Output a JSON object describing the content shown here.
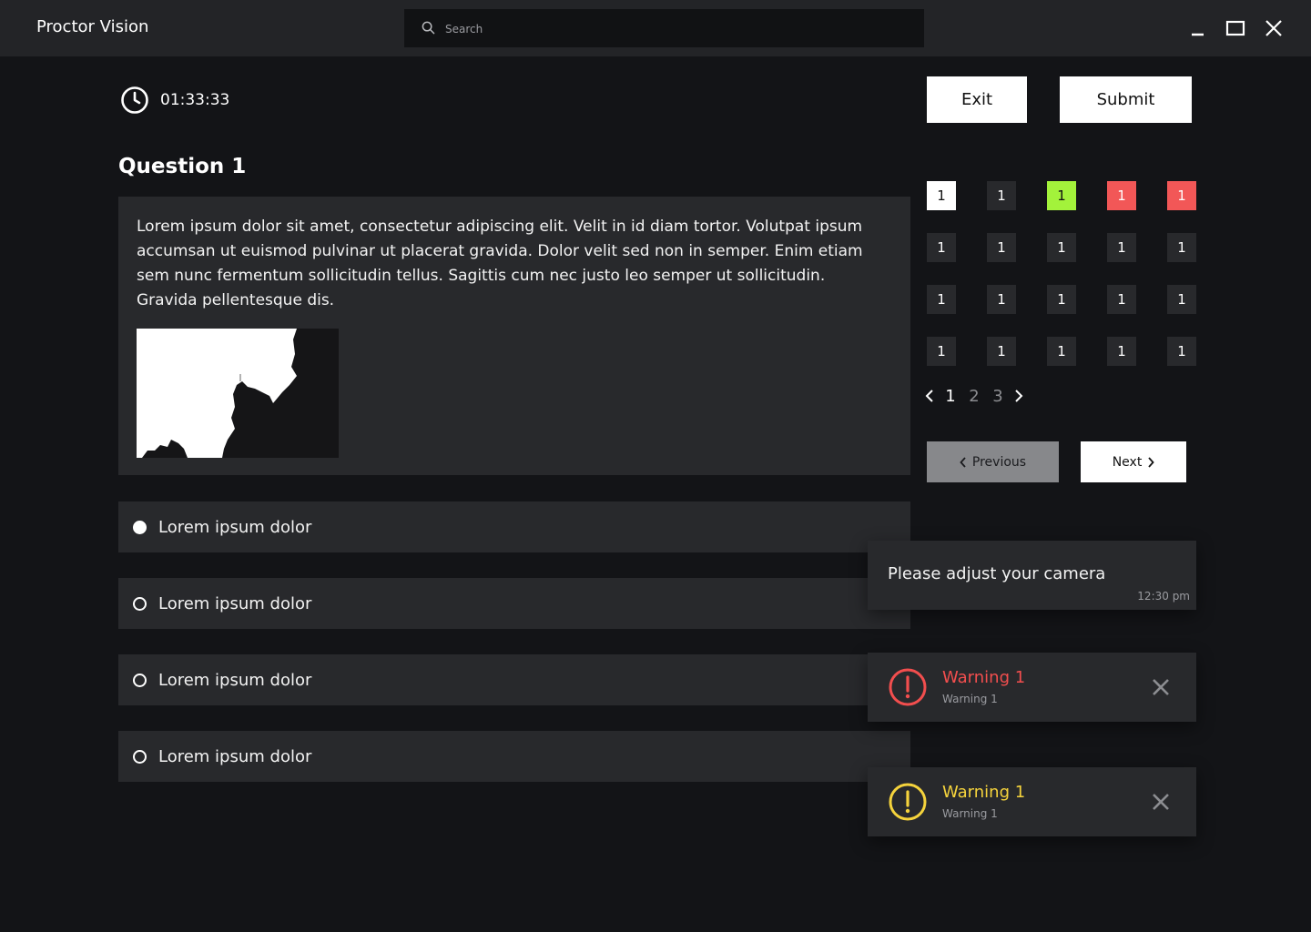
{
  "app": {
    "title": "Proctor Vision"
  },
  "search": {
    "placeholder": "Search"
  },
  "timer": {
    "value": "01:33:33"
  },
  "actions": {
    "exit": "Exit",
    "submit": "Submit"
  },
  "question": {
    "title": "Question 1",
    "text": "Lorem ipsum dolor sit amet, consectetur adipiscing elit. Velit in id diam tortor. Volutpat ipsum accumsan ut euismod pulvinar ut placerat gravida. Dolor velit sed non in semper. Enim etiam sem nunc fermentum sollicitudin tellus. Sagittis cum nec justo leo semper ut sollicitudin. Gravida pellentesque dis."
  },
  "options": [
    {
      "label": "Lorem ipsum dolor",
      "selected": true
    },
    {
      "label": "Lorem ipsum dolor",
      "selected": false
    },
    {
      "label": "Lorem ipsum dolor",
      "selected": false
    },
    {
      "label": "Lorem ipsum dolor",
      "selected": false
    }
  ],
  "question_grid": [
    {
      "label": "1",
      "status": "current"
    },
    {
      "label": "1",
      "status": "default"
    },
    {
      "label": "1",
      "status": "answered"
    },
    {
      "label": "1",
      "status": "flagged"
    },
    {
      "label": "1",
      "status": "flagged"
    },
    {
      "label": "1",
      "status": "default"
    },
    {
      "label": "1",
      "status": "default"
    },
    {
      "label": "1",
      "status": "default"
    },
    {
      "label": "1",
      "status": "default"
    },
    {
      "label": "1",
      "status": "default"
    },
    {
      "label": "1",
      "status": "default"
    },
    {
      "label": "1",
      "status": "default"
    },
    {
      "label": "1",
      "status": "default"
    },
    {
      "label": "1",
      "status": "default"
    },
    {
      "label": "1",
      "status": "default"
    },
    {
      "label": "1",
      "status": "default"
    },
    {
      "label": "1",
      "status": "default"
    },
    {
      "label": "1",
      "status": "default"
    },
    {
      "label": "1",
      "status": "default"
    },
    {
      "label": "1",
      "status": "default"
    }
  ],
  "pagination": {
    "pages": [
      "1",
      "2",
      "3"
    ],
    "current": "1"
  },
  "navigation": {
    "previous": "Previous",
    "next": "Next"
  },
  "message": {
    "text": "Please adjust your camera",
    "time": "12:30 pm"
  },
  "warnings": [
    {
      "title": "Warning 1",
      "subtitle": "Warning 1",
      "color": "#f24e4e",
      "icon": "alert-circle-icon"
    },
    {
      "title": "Warning 1",
      "subtitle": "Warning 1",
      "color": "#f5d33c",
      "icon": "alert-circle-icon"
    }
  ],
  "colors": {
    "background": "#131417",
    "panel": "#28292c",
    "titlebar": "#232427",
    "answered": "#a3f23b",
    "flagged": "#f25757",
    "current": "#ffffff"
  }
}
